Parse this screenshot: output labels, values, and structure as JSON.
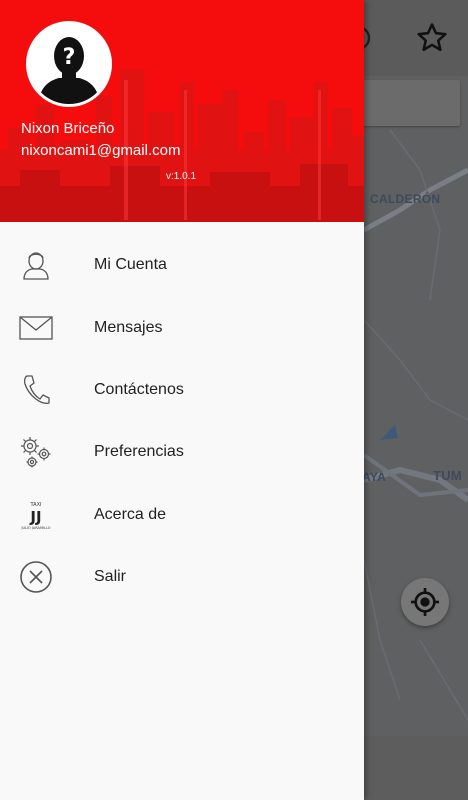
{
  "drawer": {
    "user_name": "Nixon Briceño",
    "user_email": "nixoncami1@gmail.com",
    "version": "v:1.0.1",
    "header_color": "#f50d0d",
    "avatar_icon": "user-silhouette-question-icon",
    "items": [
      {
        "label": "Mi Cuenta",
        "icon": "user-icon"
      },
      {
        "label": "Mensajes",
        "icon": "envelope-icon"
      },
      {
        "label": "Contáctenos",
        "icon": "phone-icon"
      },
      {
        "label": "Preferencias",
        "icon": "gears-icon"
      },
      {
        "label": "Acerca de",
        "icon": "taxi-logo-icon"
      },
      {
        "label": "Salir",
        "icon": "close-circle-icon"
      }
    ]
  },
  "map": {
    "labels": [
      "CALDERÓN",
      "AYA",
      "TUM"
    ],
    "logo_text": [
      "TAXI",
      "JJ",
      "JULIO JARAMILLO"
    ]
  }
}
